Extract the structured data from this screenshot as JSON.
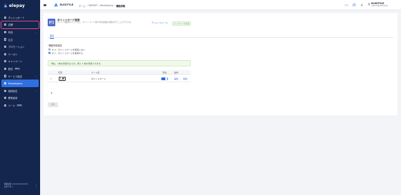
{
  "sidebar": {
    "logo_text": "elepay",
    "items": [
      {
        "label": "ダッシュボード",
        "icon": "dashboard-icon",
        "state": "normal",
        "beta": "",
        "chevron": false
      },
      {
        "label": "店舗",
        "icon": "store-icon",
        "state": "outlined",
        "beta": "",
        "chevron": false
      },
      {
        "label": "商品",
        "icon": "product-icon",
        "state": "normal",
        "beta": "",
        "chevron": true
      },
      {
        "label": "注文",
        "icon": "order-icon",
        "state": "normal",
        "beta": "",
        "chevron": false
      },
      {
        "label": "プロモーション",
        "icon": "promotion-icon",
        "state": "normal",
        "beta": "",
        "chevron": false
      },
      {
        "label": "クーポン",
        "icon": "coupon-icon",
        "state": "normal",
        "beta": "",
        "chevron": false
      },
      {
        "label": "キャンペーン",
        "icon": "campaign-icon",
        "state": "normal",
        "beta": "",
        "chevron": false
      },
      {
        "label": "配信",
        "icon": "broadcast-icon",
        "state": "normal",
        "beta": "BETA",
        "chevron": false
      },
      {
        "label": "サービス設定",
        "icon": "settings-icon",
        "state": "normal",
        "beta": "",
        "chevron": true
      },
      {
        "label": "Marketplace",
        "icon": "marketplace-icon",
        "state": "active",
        "beta": "",
        "chevron": false
      },
      {
        "label": "接続設定",
        "icon": "connection-icon",
        "state": "normal",
        "beta": "",
        "chevron": true
      },
      {
        "label": "開発者用",
        "icon": "developer-icon",
        "state": "normal",
        "beta": "",
        "chevron": false
      },
      {
        "label": "ツール",
        "icon": "tool-icon",
        "state": "normal",
        "beta": "BETA",
        "chevron": false
      }
    ],
    "footer_user_line1": "運営担当",
    "footer_user_line2": "ログアウト"
  },
  "topbar": {
    "brand_name": "ELESTYLE",
    "breadcrumbs": [
      "ホーム",
      "ONESEP",
      "Marketplace",
      "機能詳細"
    ],
    "user_name": "ELESTYLE",
    "user_email": "support@elestyle.jp"
  },
  "main": {
    "header_title": "ポイントカード設定",
    "header_desc": "ポイント機能をオンにすると、ポイントカード発行や利用履歴の閲覧を行うことができます。",
    "header_link": "アンインストール",
    "header_badge": "インストール済み",
    "tab_label": "設定",
    "option_title": "機能利用設定",
    "option_required_mark": "*",
    "radio_options": [
      {
        "label": "オフ：ポイントカードを使用しない",
        "selected": false
      },
      {
        "label": "オン：ポイントカードを使用する",
        "selected": true
      }
    ],
    "alert_text": "現在、1枚を登録済みです。残り 1 枚を登録できます。",
    "table_headers": {
      "image": "写真",
      "name": "カード名",
      "enabled": "有効",
      "actions": "操作"
    },
    "rows": [
      {
        "name": "ポイントカード",
        "enabled": true,
        "edit": "編集",
        "delete": "削除"
      }
    ],
    "add_label": "+",
    "save_label": "保存"
  },
  "colors": {
    "sidebar_bg": "#14264d",
    "active": "#2f6fe0",
    "outline": "#e04b7a",
    "success": "#5aa35a"
  }
}
